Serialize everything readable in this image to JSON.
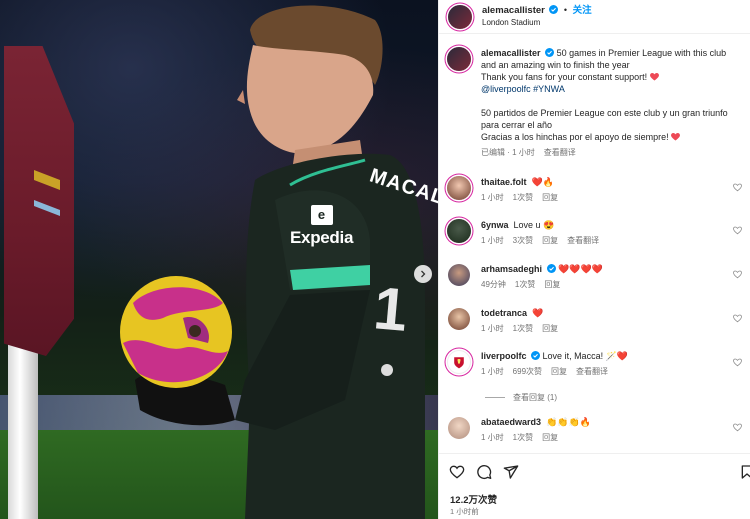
{
  "post": {
    "username": "alemacallister",
    "follow_label": "关注",
    "location": "London Stadium",
    "caption_line1": "50 games in Premier League with this club and an amazing win to finish the year",
    "caption_line2": "Thank you fans for your constant support! ",
    "caption_tags": "@liverpoolfc #YNWA",
    "caption_es1": "50 partidos de Premier League con este club y un gran triunfo para cerrar el año",
    "caption_es2": "Gracias a los hinchas por el apoyo de siempre! ",
    "caption_meta_edited": "已编辑",
    "caption_meta_time": "1 小时",
    "caption_meta_translate": "查看翻译",
    "jersey_sponsor": "Expedia",
    "jersey_name": "MACALL",
    "likes": "12.2万次赞",
    "time_ago": "1 小时前"
  },
  "comments": [
    {
      "username": "thaitae.folt",
      "text": "",
      "emoji": "❤️🔥",
      "time": "1 小时",
      "likes": "1次赞",
      "reply": "回复",
      "translate": ""
    },
    {
      "username": "6ynwa",
      "text": "Love u ",
      "emoji": "😍",
      "time": "1 小时",
      "likes": "3次赞",
      "reply": "回复",
      "translate": "查看翻译"
    },
    {
      "username": "arhamsadeghi",
      "text": "",
      "emoji": "❤️❤️❤️❤️",
      "time": "49分钟",
      "likes": "1次赞",
      "reply": "回复",
      "translate": "",
      "verified": true
    },
    {
      "username": "todetranca",
      "text": "",
      "emoji": "❤️",
      "time": "1 小时",
      "likes": "1次赞",
      "reply": "回复",
      "translate": ""
    },
    {
      "username": "liverpoolfc",
      "text": "Love it, Macca! ",
      "emoji": "🪄❤️",
      "time": "1 小时",
      "likes": "699次赞",
      "reply": "回复",
      "translate": "查看翻译",
      "verified": true
    },
    {
      "username": "abataedward3",
      "text": "",
      "emoji": "👏👏👏🔥",
      "time": "1 小时",
      "likes": "1次赞",
      "reply": "回复",
      "translate": ""
    }
  ],
  "view_replies": "查看回复 (1)",
  "colors": {
    "accent": "#0095f6",
    "heart": "#ed4956",
    "hashtag": "#00376b",
    "verified": "#0095f6"
  }
}
